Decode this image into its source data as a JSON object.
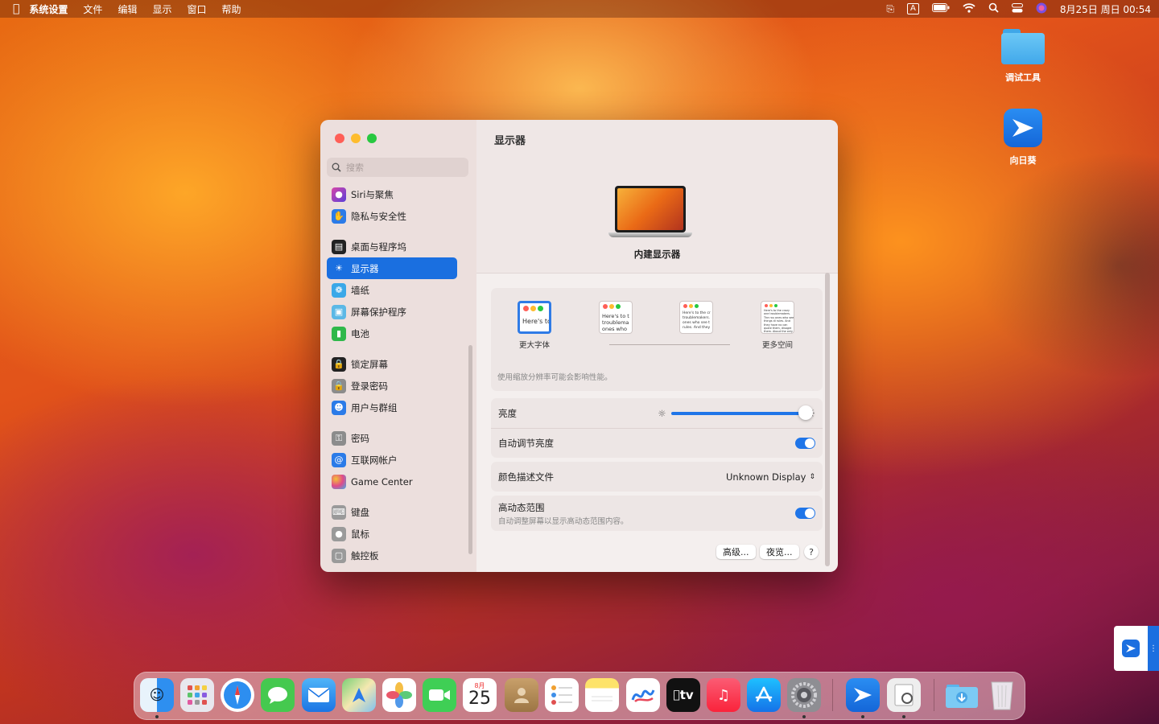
{
  "menubar": {
    "app_name": "系统设置",
    "items": [
      "文件",
      "编辑",
      "显示",
      "窗口",
      "帮助"
    ],
    "input_mode": "A",
    "datetime": "8月25日 周日 00:54"
  },
  "desktop": {
    "icons": [
      {
        "label": "调试工具",
        "type": "folder"
      },
      {
        "label": "向日葵",
        "type": "app"
      }
    ]
  },
  "window": {
    "search_placeholder": "搜索",
    "sidebar_items": [
      {
        "label": "Siri与聚焦",
        "icon": "siri-icon",
        "color": "#8a3fd0"
      },
      {
        "label": "隐私与安全性",
        "icon": "hand-icon",
        "color": "#2b7be8"
      },
      {
        "label": "桌面与程序坞",
        "icon": "dock-icon",
        "color": "#222222"
      },
      {
        "label": "显示器",
        "icon": "sun-icon",
        "color": "#2b7be8",
        "active": true
      },
      {
        "label": "墙纸",
        "icon": "flower-icon",
        "color": "#3aa8e8"
      },
      {
        "label": "屏幕保护程序",
        "icon": "screensaver-icon",
        "color": "#5bb8e6"
      },
      {
        "label": "电池",
        "icon": "battery-icon",
        "color": "#2fb84a"
      },
      {
        "label": "锁定屏幕",
        "icon": "lock-icon",
        "color": "#222222"
      },
      {
        "label": "登录密码",
        "icon": "padlock-icon",
        "color": "#8c8c8c"
      },
      {
        "label": "用户与群组",
        "icon": "users-icon",
        "color": "#2b7be8"
      },
      {
        "label": "密码",
        "icon": "key-icon",
        "color": "#8c8c8c"
      },
      {
        "label": "互联网帐户",
        "icon": "at-icon",
        "color": "#2b7be8"
      },
      {
        "label": "Game Center",
        "icon": "game-center-icon",
        "color": "#e04a8a"
      },
      {
        "label": "键盘",
        "icon": "keyboard-icon",
        "color": "#9a9a9a"
      },
      {
        "label": "鼠标",
        "icon": "mouse-icon",
        "color": "#9a9a9a"
      },
      {
        "label": "触控板",
        "icon": "trackpad-icon",
        "color": "#9a9a9a"
      }
    ],
    "title": "显示器",
    "display_name": "内建显示器",
    "resolution": {
      "options": [
        {
          "label": "更大字体",
          "preview": "Here's to troublem",
          "selected": true
        },
        {
          "label": "",
          "preview": "Here's to t troublema ones who"
        },
        {
          "label": "",
          "preview": "Here's to the cr troublemakers. ones who see t rules. And they"
        },
        {
          "label": "更多空间",
          "preview": "Here's to the crazy one troublemakers. The rou ones who see things di rules. And they have no can quote them, disagre them. About the only th Because they change th"
        }
      ],
      "note": "使用缩放分辨率可能会影响性能。"
    },
    "brightness_label": "亮度",
    "brightness_level": 1.0,
    "auto_brightness_label": "自动调节亮度",
    "auto_brightness_on": true,
    "color_profile_label": "颜色描述文件",
    "color_profile_value": "Unknown Display",
    "hdr_label": "高动态范围",
    "hdr_desc": "自动调整屏幕以显示高动态范围内容。",
    "hdr_on": true,
    "buttons": {
      "advanced": "高级...",
      "night_shift": "夜览...",
      "help": "?"
    }
  },
  "dock": {
    "apps": [
      "finder",
      "launchpad",
      "safari",
      "messages",
      "mail",
      "maps",
      "photos",
      "facetime",
      "calendar",
      "contacts",
      "reminders",
      "notes",
      "freeform",
      "tv",
      "music",
      "app-store",
      "system-settings",
      "sunlogin",
      "preview",
      "downloads",
      "trash"
    ],
    "calendar_month": "8月",
    "calendar_day": "25",
    "tv_label": "tv"
  }
}
